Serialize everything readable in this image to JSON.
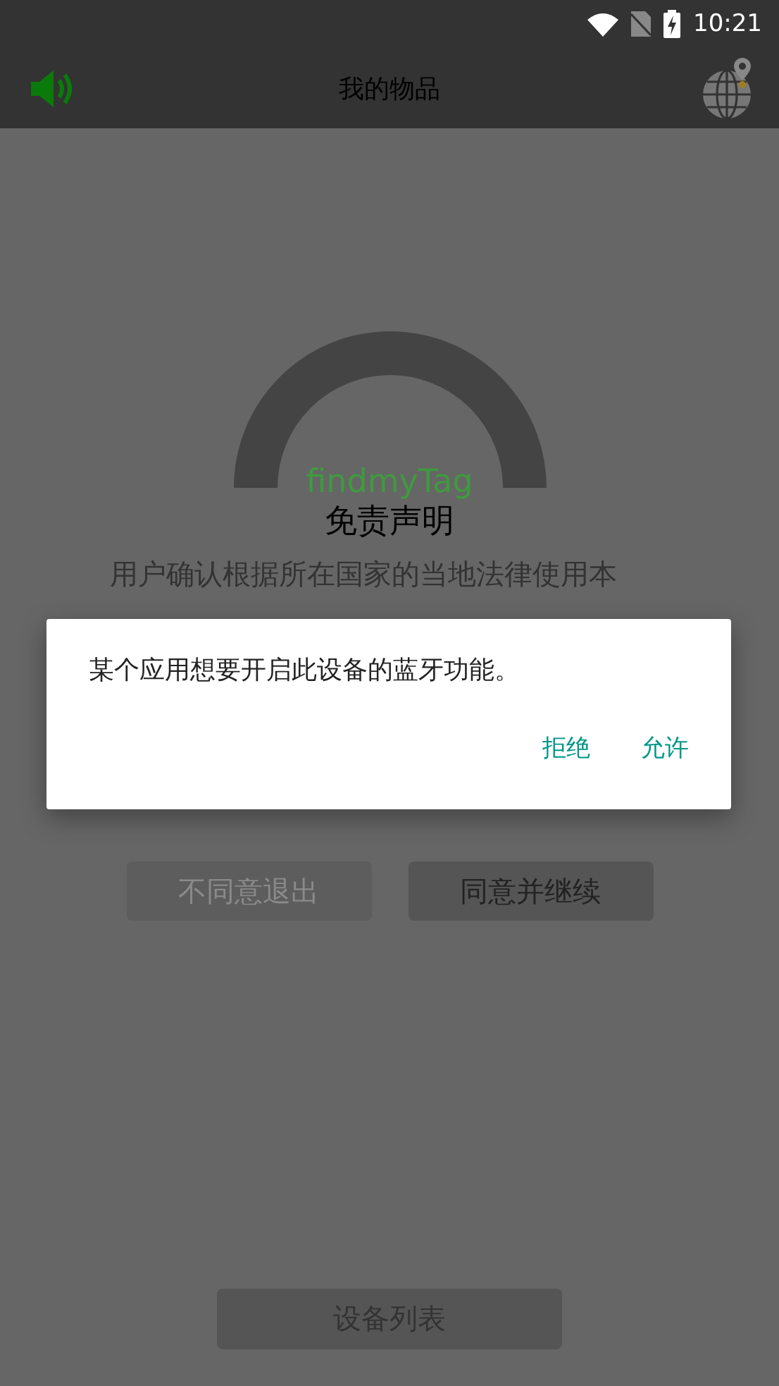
{
  "status_bar": {
    "time": "10:21"
  },
  "app_bar": {
    "title": "我的物品"
  },
  "disclaimer": {
    "app_name": "findmyTag",
    "title": "免责声明",
    "lines": [
      "用户确认根据所在国家的当地法律使用本"
    ],
    "buttons": [
      {
        "label": "不同意退出",
        "disabled": true
      },
      {
        "label": "同意并继续",
        "disabled": false
      }
    ]
  },
  "bottom_button": {
    "label": "设备列表"
  },
  "system_dialog": {
    "message": "某个应用想要开启此设备的蓝牙功能。",
    "buttons": [
      "拒绝",
      "允许"
    ]
  }
}
